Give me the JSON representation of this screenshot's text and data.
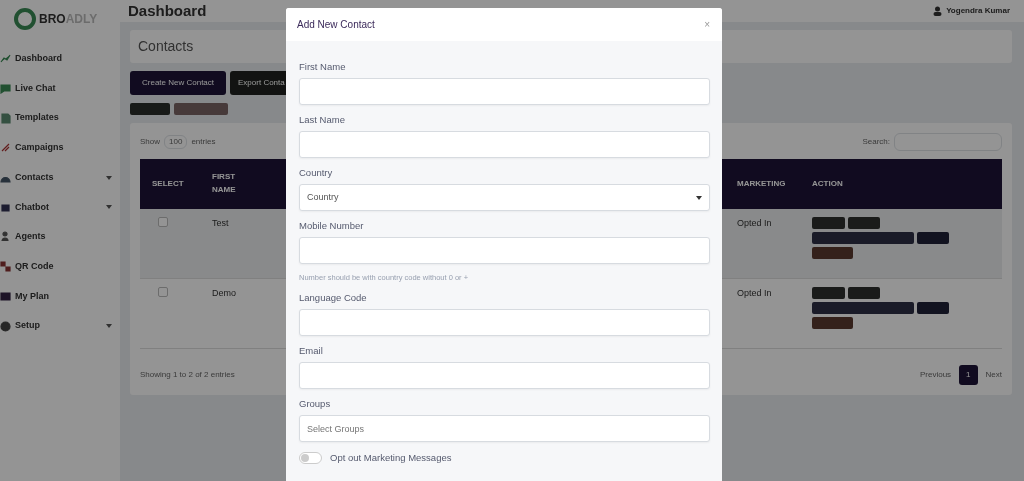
{
  "sidebar": {
    "logo": {
      "strong": "BRO",
      "light": "ADLY"
    },
    "items": [
      {
        "label": "Dashboard",
        "expandable": false
      },
      {
        "label": "Live Chat",
        "expandable": false
      },
      {
        "label": "Templates",
        "expandable": false
      },
      {
        "label": "Campaigns",
        "expandable": false
      },
      {
        "label": "Contacts",
        "expandable": true
      },
      {
        "label": "Chatbot",
        "expandable": true
      },
      {
        "label": "Agents",
        "expandable": false
      },
      {
        "label": "QR Code",
        "expandable": false
      },
      {
        "label": "My Plan",
        "expandable": false
      },
      {
        "label": "Setup",
        "expandable": true
      }
    ]
  },
  "header": {
    "title": "Dashboard",
    "user": "Yogendra Kumar"
  },
  "page": {
    "title": "Contacts",
    "buttons": [
      "Create New Contact",
      "Export Conta"
    ],
    "table": {
      "show_label": "Show",
      "length": "100",
      "entries_label": "entries",
      "search_label": "Search:",
      "columns": [
        "SELECT",
        "FIRST NAME",
        "MARKETING",
        "ACTION"
      ],
      "rows": [
        {
          "checked": false,
          "first_name": "Test",
          "marketing": "Opted In"
        },
        {
          "checked": false,
          "first_name": "Demo",
          "marketing": "Opted In"
        }
      ],
      "info": "Showing 1 to 2 of 2 entries",
      "pagination": [
        {
          "label": "Previous",
          "selected": false
        },
        {
          "label": "1",
          "selected": true
        },
        {
          "label": "Next",
          "selected": false
        }
      ]
    }
  },
  "modal": {
    "title": "Add New Contact",
    "close": "×",
    "fields": [
      {
        "kind": "input",
        "label": "First Name"
      },
      {
        "kind": "input",
        "label": "Last Name"
      },
      {
        "kind": "select",
        "label": "Country",
        "placeholder": "Country"
      },
      {
        "kind": "input",
        "label": "Mobile Number",
        "help": "Number should be with country code without 0 or +"
      },
      {
        "kind": "input",
        "label": "Language Code"
      },
      {
        "kind": "input",
        "label": "Email"
      },
      {
        "kind": "input",
        "label": "Groups",
        "placeholder": "Select Groups"
      },
      {
        "kind": "toggle",
        "label": "Opt out Marketing Messages",
        "on": false
      }
    ]
  }
}
